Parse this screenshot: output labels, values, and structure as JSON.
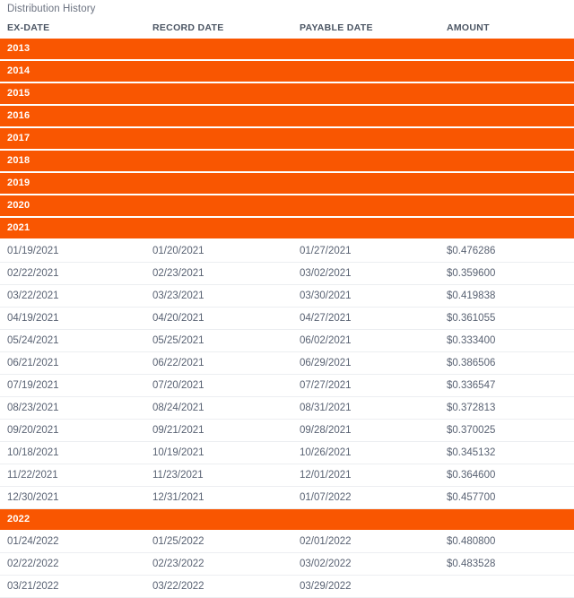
{
  "panel": {
    "title": "Distribution History",
    "accent_color": "#f95601",
    "header_text_color": "#4b5563",
    "body_text_color": "#596273",
    "title_text_color": "#6b7280",
    "row_separator_color": "#eceef1"
  },
  "table": {
    "columns": [
      {
        "key": "ex_date",
        "label": "EX-DATE"
      },
      {
        "key": "record_date",
        "label": "RECORD DATE"
      },
      {
        "key": "payable_date",
        "label": "PAYABLE DATE"
      },
      {
        "key": "amount",
        "label": "AMOUNT"
      }
    ],
    "rows": [
      {
        "type": "year",
        "year": "2013"
      },
      {
        "type": "year",
        "year": "2014"
      },
      {
        "type": "year",
        "year": "2015"
      },
      {
        "type": "year",
        "year": "2016"
      },
      {
        "type": "year",
        "year": "2017"
      },
      {
        "type": "year",
        "year": "2018"
      },
      {
        "type": "year",
        "year": "2019"
      },
      {
        "type": "year",
        "year": "2020"
      },
      {
        "type": "year",
        "year": "2021"
      },
      {
        "type": "data",
        "ex_date": "01/19/2021",
        "record_date": "01/20/2021",
        "payable_date": "01/27/2021",
        "amount": "$0.476286"
      },
      {
        "type": "data",
        "ex_date": "02/22/2021",
        "record_date": "02/23/2021",
        "payable_date": "03/02/2021",
        "amount": "$0.359600"
      },
      {
        "type": "data",
        "ex_date": "03/22/2021",
        "record_date": "03/23/2021",
        "payable_date": "03/30/2021",
        "amount": "$0.419838"
      },
      {
        "type": "data",
        "ex_date": "04/19/2021",
        "record_date": "04/20/2021",
        "payable_date": "04/27/2021",
        "amount": "$0.361055"
      },
      {
        "type": "data",
        "ex_date": "05/24/2021",
        "record_date": "05/25/2021",
        "payable_date": "06/02/2021",
        "amount": "$0.333400"
      },
      {
        "type": "data",
        "ex_date": "06/21/2021",
        "record_date": "06/22/2021",
        "payable_date": "06/29/2021",
        "amount": "$0.386506"
      },
      {
        "type": "data",
        "ex_date": "07/19/2021",
        "record_date": "07/20/2021",
        "payable_date": "07/27/2021",
        "amount": "$0.336547"
      },
      {
        "type": "data",
        "ex_date": "08/23/2021",
        "record_date": "08/24/2021",
        "payable_date": "08/31/2021",
        "amount": "$0.372813"
      },
      {
        "type": "data",
        "ex_date": "09/20/2021",
        "record_date": "09/21/2021",
        "payable_date": "09/28/2021",
        "amount": "$0.370025"
      },
      {
        "type": "data",
        "ex_date": "10/18/2021",
        "record_date": "10/19/2021",
        "payable_date": "10/26/2021",
        "amount": "$0.345132"
      },
      {
        "type": "data",
        "ex_date": "11/22/2021",
        "record_date": "11/23/2021",
        "payable_date": "12/01/2021",
        "amount": "$0.364600"
      },
      {
        "type": "data",
        "ex_date": "12/30/2021",
        "record_date": "12/31/2021",
        "payable_date": "01/07/2022",
        "amount": "$0.457700"
      },
      {
        "type": "year",
        "year": "2022"
      },
      {
        "type": "data",
        "ex_date": "01/24/2022",
        "record_date": "01/25/2022",
        "payable_date": "02/01/2022",
        "amount": "$0.480800"
      },
      {
        "type": "data",
        "ex_date": "02/22/2022",
        "record_date": "02/23/2022",
        "payable_date": "03/02/2022",
        "amount": "$0.483528"
      },
      {
        "type": "data",
        "ex_date": "03/21/2022",
        "record_date": "03/22/2022",
        "payable_date": "03/29/2022",
        "amount": ""
      }
    ]
  }
}
